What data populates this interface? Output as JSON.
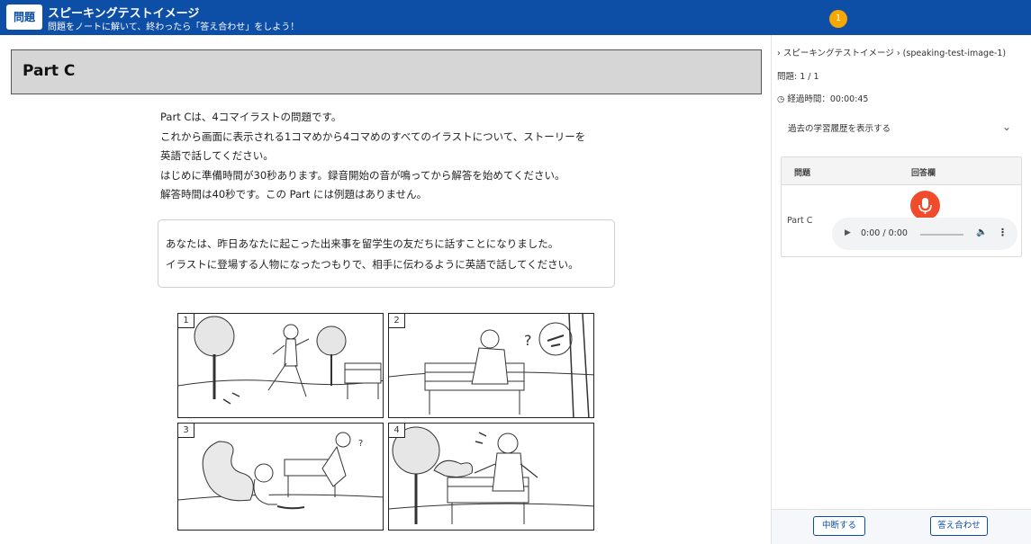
{
  "header": {
    "badge": "問題",
    "title": "スピーキングテストイメージ",
    "subtitle": "問題をノートに解いて、終わったら「答え合わせ」をしよう！",
    "notification_count": "1",
    "brand_color": "#0d4ea6",
    "notification_color": "#f6a800"
  },
  "main": {
    "part_title": "Part C",
    "instructions": [
      "Part Cは、4コマイラストの問題です。",
      "これから画面に表示される1コマめから4コマめのすべてのイラストについて、ストーリーを",
      "英語で話してください。",
      "はじめに準備時間が30秒あります。録音開始の音が鳴ってから解答を始めてください。",
      "解答時間は40秒です。この Part には例題はありません。"
    ],
    "scenario": [
      "あなたは、昨日あなたに起こった出来事を留学生の友だちに話すことになりました。",
      "イラストに登場する人物になったつもりで、相手に伝わるように英語で話してください。"
    ],
    "panels": [
      {
        "number": "1"
      },
      {
        "number": "2"
      },
      {
        "number": "3"
      },
      {
        "number": "4"
      }
    ]
  },
  "sidebar": {
    "breadcrumb": "› スピーキングテストイメージ › (speaking-test-image-1)",
    "question_count": "問題: 1 / 1",
    "elapsed": "経過時間：00:00:45",
    "history_toggle": "過去の学習履歴を表示する",
    "table": {
      "col_question": "問題",
      "col_answer": "回答欄",
      "row_label": "Part C",
      "mic_color": "#ef4b2c",
      "audio_time": "0:00 / 0:00"
    },
    "buttons": {
      "pause": "中断する",
      "check": "答え合わせ"
    }
  }
}
